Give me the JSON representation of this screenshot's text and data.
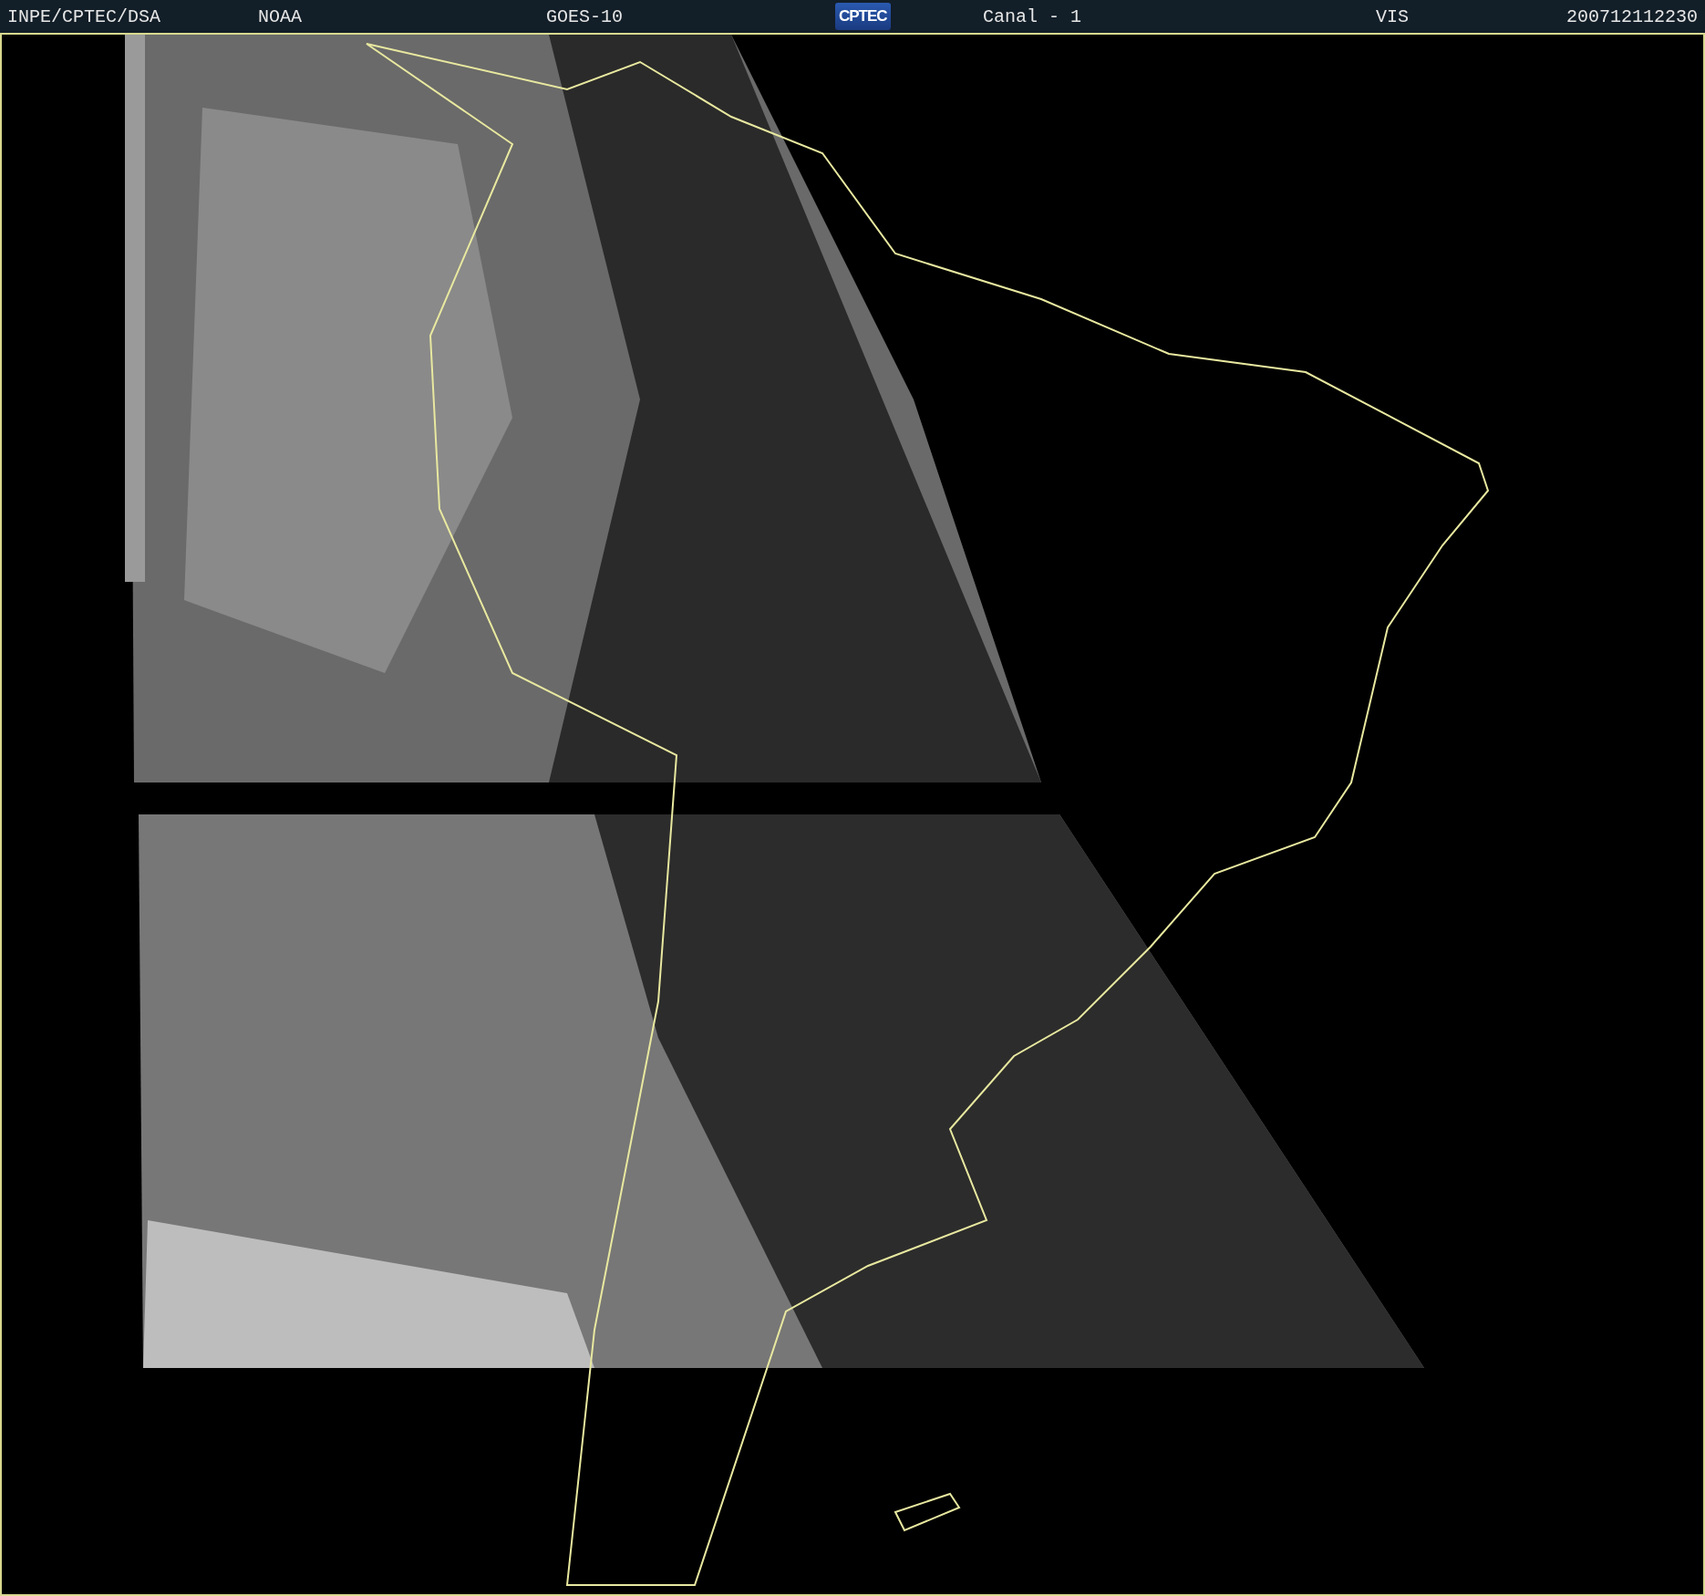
{
  "header": {
    "items": [
      {
        "kind": "text",
        "text": "INPE/CPTEC/DSA"
      },
      {
        "kind": "text",
        "text": "NOAA"
      },
      {
        "kind": "text",
        "text": "GOES-10"
      },
      {
        "kind": "logo",
        "text": "CPTEC"
      },
      {
        "kind": "text",
        "text": "Canal - 1"
      },
      {
        "kind": "text",
        "text": "VIS"
      },
      {
        "kind": "text",
        "text": "200712112230"
      }
    ]
  }
}
